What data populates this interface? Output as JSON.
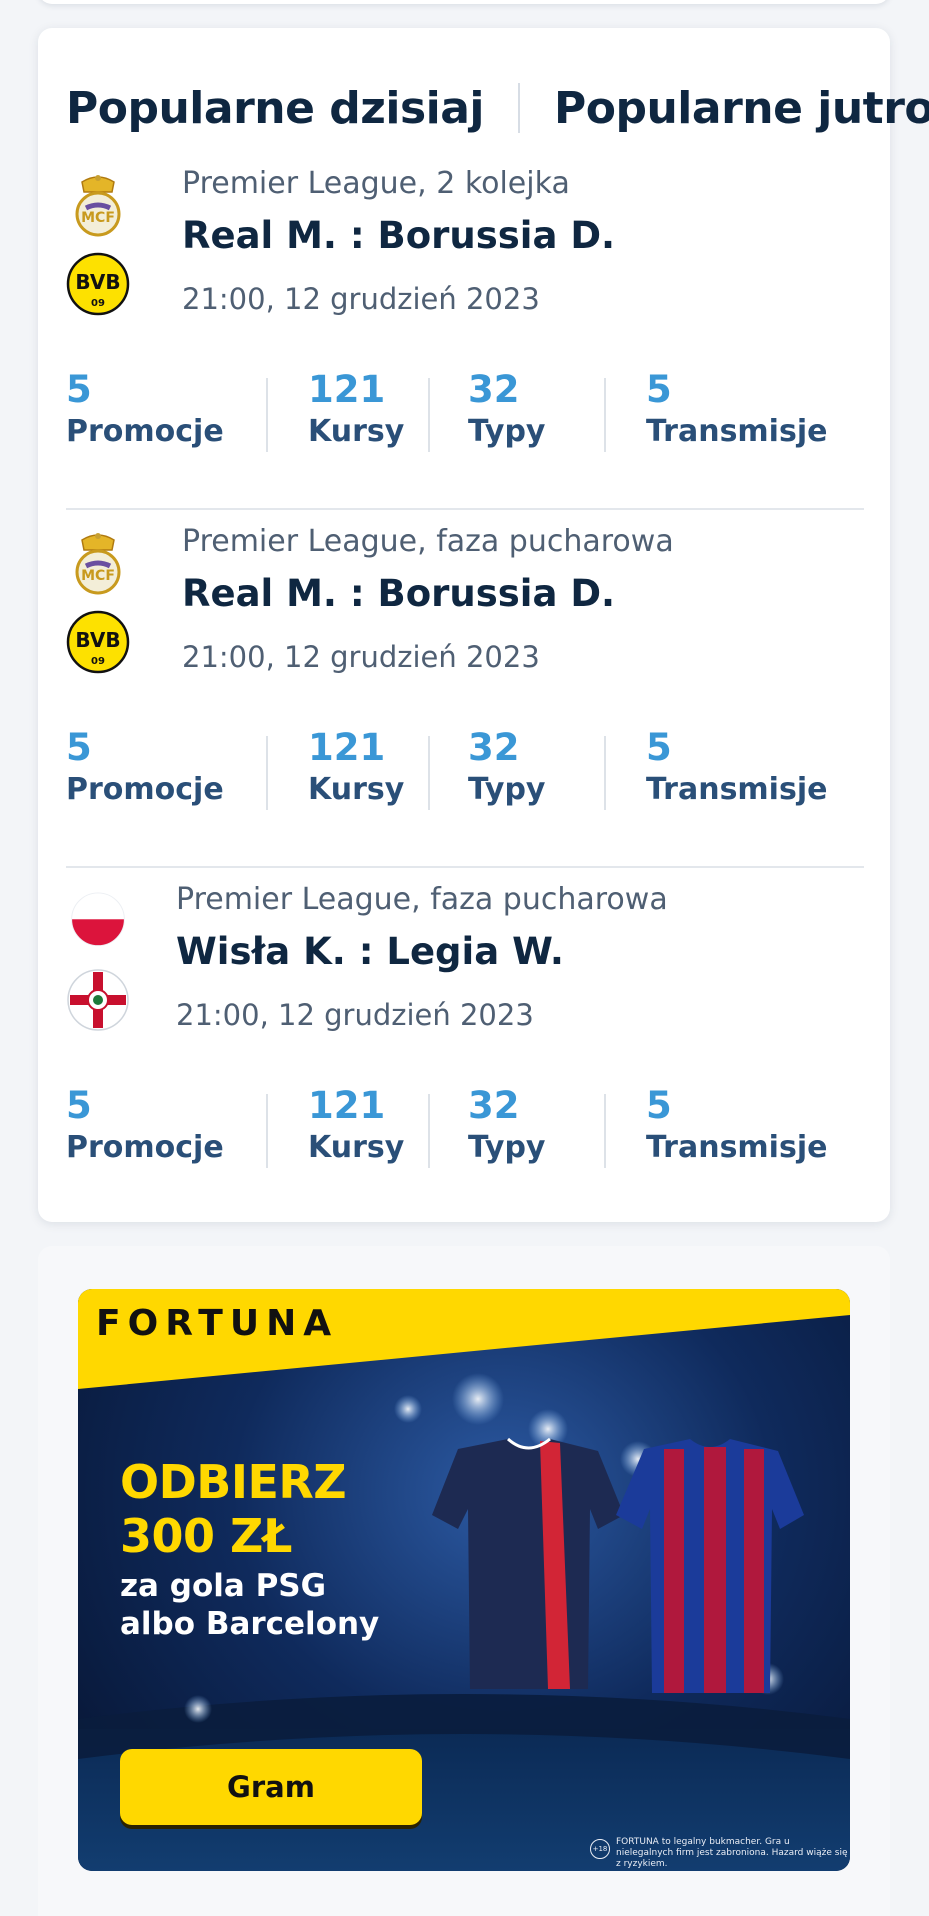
{
  "tabs": [
    "Popularne dzisiaj",
    "Popularne jutro"
  ],
  "matches": [
    {
      "league": "Premier League, 2 kolejka",
      "teams": "Real M. : Borussia D.",
      "datetime": "21:00, 12 grudzień 2023",
      "home_crest": "real-madrid-crest",
      "away_crest": "bvb-crest",
      "stats": [
        {
          "value": "5",
          "label": "Promocje"
        },
        {
          "value": "121",
          "label": "Kursy"
        },
        {
          "value": "32",
          "label": "Typy"
        },
        {
          "value": "5",
          "label": "Transmisje"
        }
      ]
    },
    {
      "league": "Premier League, faza pucharowa",
      "teams": "Real M. : Borussia D.",
      "datetime": "21:00, 12 grudzień 2023",
      "home_crest": "real-madrid-crest",
      "away_crest": "bvb-crest",
      "stats": [
        {
          "value": "5",
          "label": "Promocje"
        },
        {
          "value": "121",
          "label": "Kursy"
        },
        {
          "value": "32",
          "label": "Typy"
        },
        {
          "value": "5",
          "label": "Transmisje"
        }
      ]
    },
    {
      "league": "Premier League, faza pucharowa",
      "teams": "Wisła K. : Legia W.",
      "datetime": "21:00, 12 grudzień 2023",
      "home_crest": "poland-flag",
      "away_crest": "cross-crest",
      "stats": [
        {
          "value": "5",
          "label": "Promocje"
        },
        {
          "value": "121",
          "label": "Kursy"
        },
        {
          "value": "32",
          "label": "Typy"
        },
        {
          "value": "5",
          "label": "Transmisje"
        }
      ]
    }
  ],
  "promo": {
    "brand": "FORTUNA",
    "headline_1": "ODBIERZ",
    "headline_2": "300 ZŁ",
    "subline_1": "za gola PSG",
    "subline_2": "albo Barcelony",
    "cta": "Gram",
    "age": "+18",
    "legal": "FORTUNA to legalny bukmacher. Gra u nielegalnych firm jest zabroniona. Hazard wiąże się z ryzykiem.",
    "brand_color": "#ffd800"
  },
  "colors": {
    "accent_blue": "#3a97d6",
    "navy": "#0f2741",
    "muted": "#4f5f73"
  }
}
